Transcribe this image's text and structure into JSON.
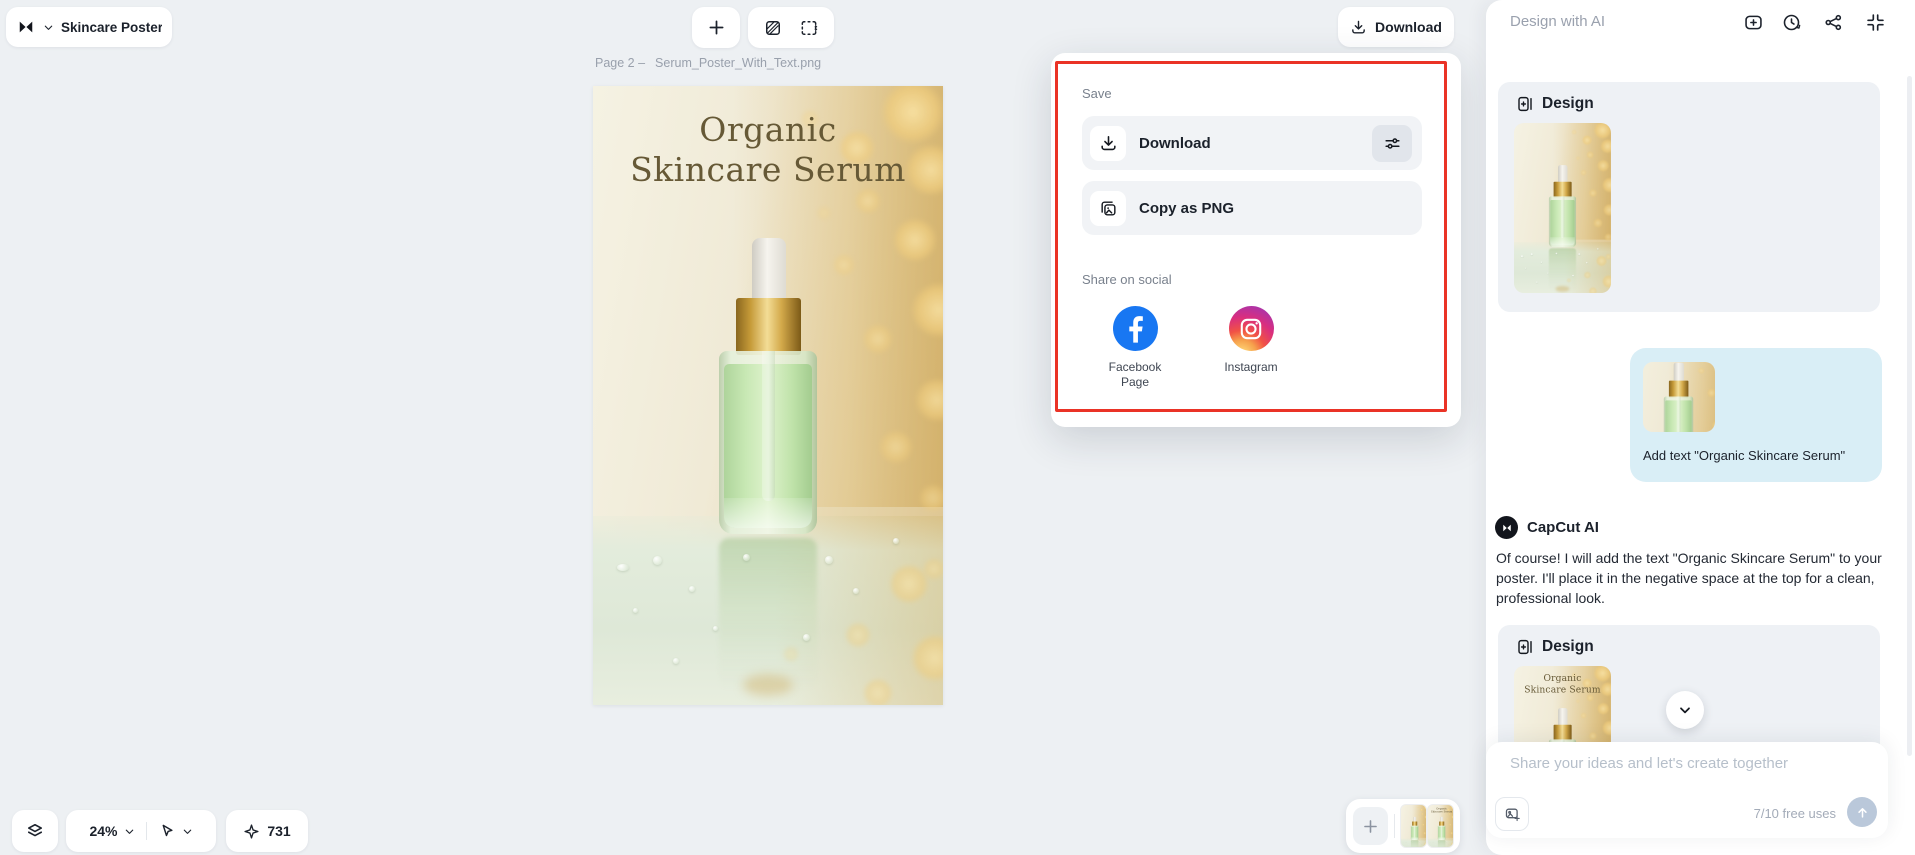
{
  "window": {
    "title": "Skincare Poster Pr..."
  },
  "topbar": {
    "download_label": "Download"
  },
  "canvas": {
    "page_label": "Page 2 –",
    "file_name": "Serum_Poster_With_Text.png",
    "zoom_value": "24%",
    "credits": "731"
  },
  "poster": {
    "title_line1": "Organic",
    "title_line2": "Skincare Serum"
  },
  "save_popup": {
    "section_save": "Save",
    "download_label": "Download",
    "copy_png_label": "Copy as PNG",
    "section_share": "Share on social",
    "facebook_label": "Facebook Page",
    "instagram_label": "Instagram"
  },
  "ai_panel": {
    "header": "Design with AI",
    "design_card_title": "Design",
    "user_message": "Add text \"Organic Skincare Serum\"",
    "assistant_name": "CapCut AI",
    "assistant_message": "Of course! I will add the text \"Organic Skincare Serum\" to your poster. I'll place it in the negative space at the top for a clean, professional look.",
    "design_card2_title": "Design",
    "input_placeholder": "Share your ideas and let's create together",
    "free_uses": "7/10 free uses"
  },
  "icons": {
    "capcut-logo": "bowtie-mark",
    "chevron-down": "v",
    "plus": "+",
    "background": "hatched-square",
    "resize": "dashed-crop",
    "download": "arrow-down-tray",
    "new-chat": "square-plus",
    "history": "clock-arrow",
    "share": "connected-nodes",
    "collapse": "inward-corners",
    "sliders": "two-knob-sliders",
    "copy-image": "stacked-image",
    "facebook": "f",
    "instagram": "camera",
    "layers": "stacked-diamonds",
    "cursor": "arrow-pointer",
    "sparkle": "four-point-star",
    "add-image": "image-plus",
    "send": "arrow-up"
  },
  "colors": {
    "annotation_red": "#ea3326",
    "facebook_blue": "#1877f2",
    "user_bubble": "#d9eef6",
    "send_button": "#bac8da",
    "panel_card": "#eef1f5"
  }
}
